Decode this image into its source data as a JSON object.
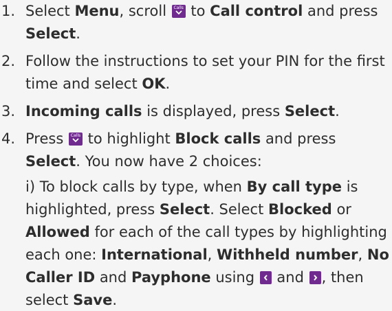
{
  "steps": [
    {
      "number": "1.",
      "parts": [
        "Select ",
        "Menu",
        ", scroll ",
        " to ",
        "Call control",
        " and press ",
        "Select",
        "."
      ]
    },
    {
      "number": "2.",
      "parts": [
        "Follow the instructions to set your PIN for the first time and select ",
        "OK",
        "."
      ]
    },
    {
      "number": "3.",
      "parts": [
        "Incoming calls",
        " is displayed, press ",
        "Select",
        "."
      ]
    },
    {
      "number": "4.",
      "parts": [
        "Press ",
        " to highlight ",
        "Block calls",
        " and press ",
        "Select",
        ". You now have 2 choices:"
      ],
      "sub_parts": [
        "i) To block calls by type, when ",
        "By call type",
        " is highlighted, press ",
        "Select",
        ". Select ",
        "Blocked",
        " or ",
        "Allowed",
        " for each of the call types by highlighting each one: ",
        "International",
        ", ",
        "Withheld number",
        ", ",
        "No Caller ID",
        " and ",
        "Payphone",
        " using ",
        " and ",
        ", then select ",
        "Save",
        "."
      ]
    }
  ],
  "icons": {
    "calls_key_label": "Calls",
    "calls_key_icon": "calls-scroll-down-icon",
    "left_key_icon": "nav-left-icon",
    "right_key_icon": "nav-right-icon",
    "key_color": "#6f2c8e"
  }
}
